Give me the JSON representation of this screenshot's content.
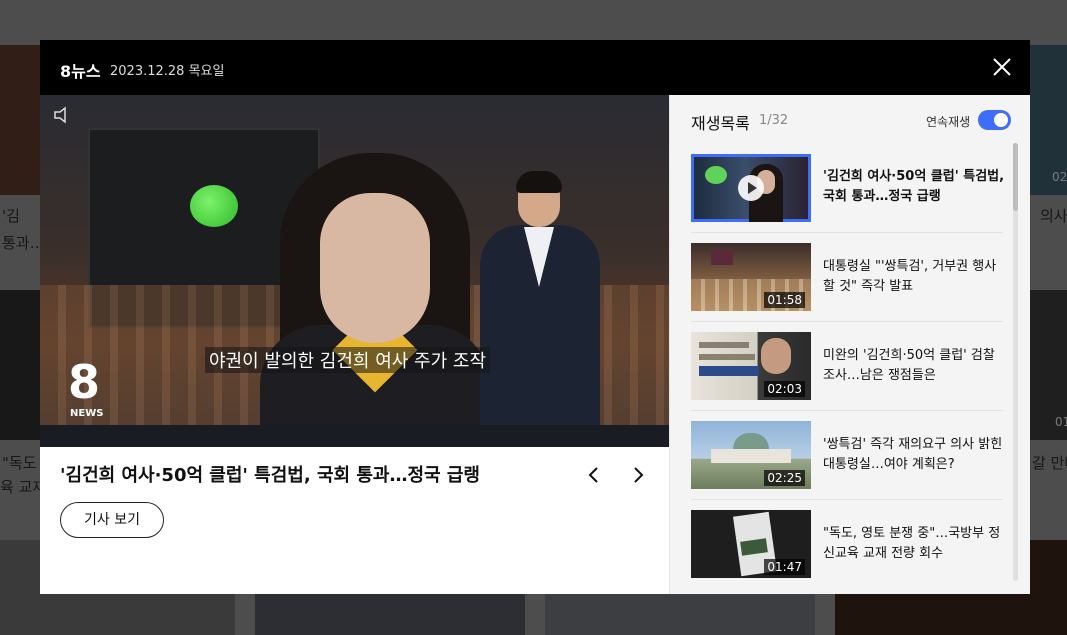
{
  "header": {
    "brand": "8뉴스",
    "date": "2023.12.28  목요일"
  },
  "video": {
    "caption": "야권이 발의한 김건희 여사 주가 조작",
    "logo_number": "8",
    "logo_text": "NEWS",
    "title": "'김건희 여사·50억 클럽' 특검법, 국회 통과…정국 급랭"
  },
  "buttons": {
    "article": "기사 보기"
  },
  "playlist": {
    "title": "재생목록",
    "count": "1/32",
    "autoplay_label": "연속재생",
    "autoplay_on": true,
    "items": [
      {
        "title": "'김건희 여사·50억 클럽' 특검법, 국회 통과…정국 급랭",
        "duration": "",
        "active": true
      },
      {
        "title": "대통령실 \"'쌍특검', 거부권 행사할 것\" 즉각 발표",
        "duration": "01:58",
        "active": false
      },
      {
        "title": "미완의 '김건희·50억 클럽' 검찰 조사…남은 쟁점들은",
        "duration": "02:03",
        "active": false
      },
      {
        "title": "'쌍특검' 즉각 재의요구 의사 밝힌 대통령실…여야 계획은?",
        "duration": "02:25",
        "active": false
      },
      {
        "title": "\"독도, 영토 분쟁 중\"…국방부 정신교육 교재 전량 회수",
        "duration": "01:47",
        "active": false
      }
    ]
  },
  "background": {
    "text_1": "'김",
    "text_2": "통과…",
    "text_3": "\"독도",
    "text_4": "육 교재",
    "text_5": "의사",
    "text_6": "갈 만나",
    "badge_1": "02",
    "badge_2": "01"
  },
  "colors": {
    "accent": "#3d6ef5",
    "header_bg": "#000000"
  }
}
